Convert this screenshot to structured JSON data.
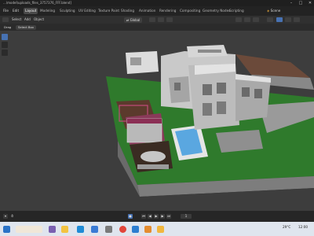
{
  "window": {
    "title": "...\\model\\uploads_files_3757376_FFF.blend]"
  },
  "menu": {
    "items": [
      "File",
      "Edit",
      "Render",
      "Window",
      "Help"
    ],
    "tabs": [
      "Layout",
      "Modeling",
      "Sculpting",
      "UV Editing",
      "Texture Paint",
      "Shading",
      "Animation",
      "Rendering",
      "Compositing",
      "Geometry Nodes",
      "Scripting"
    ],
    "active_tab": "Layout",
    "scene_label": "Scene"
  },
  "viewport_header": {
    "items": [
      "Object Mode",
      "View",
      "Select",
      "Add",
      "Object"
    ],
    "shading": "Global"
  },
  "tool_header": {
    "drag_label": "Drag",
    "select_box": "Select Box"
  },
  "colors": {
    "accent": "#4772b3",
    "grass": "#2f7a2c",
    "pool": "#5aa7e0"
  },
  "taskbar": {
    "weather": "29°C",
    "clock_time": "12:00",
    "icons": [
      "windows-icon",
      "search-icon",
      "task-view-icon",
      "file-explorer-icon",
      "edge-icon",
      "chrome-icon",
      "store-icon",
      "blender-icon",
      "folder-icon"
    ]
  },
  "timeline": {
    "frame": "1"
  }
}
